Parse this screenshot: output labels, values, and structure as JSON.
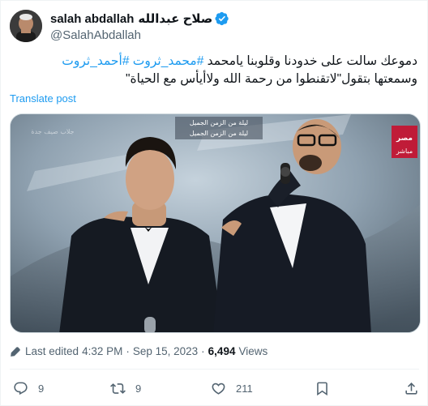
{
  "author": {
    "display_name": "salah abdallah",
    "display_name_ar": "صلاح عبدالله",
    "handle": "@SalahAbdallah"
  },
  "tweet": {
    "line1_prefix": "دموعك سالت على خدودنا وقلوبنا يامحمد ",
    "hashtag1": "#محمد_ثروت",
    "hashtag2": "#أحمد_ثروت",
    "line2": "وسمعتها بتقول\"لاتقنطوا من رحمة الله ولاأيأس مع الحياة\""
  },
  "translate_label": "Translate post",
  "media": {
    "banner_text_1": "ليلة من الزمن الجميل",
    "banner_text_2": "ليلة من الزمن الجميل",
    "channel_text": "مباشر",
    "channel_logo": "مصر",
    "watermark": "جلاب صيف جدة"
  },
  "meta": {
    "edited_label": "Last edited",
    "time": "4:32 PM",
    "date": "Sep 15, 2023",
    "views_count": "6,494",
    "views_label": "Views"
  },
  "actions": {
    "replies": "9",
    "reposts": "9",
    "likes": "211"
  },
  "colors": {
    "accent": "#1d9bf0",
    "secondary_text": "#536471"
  }
}
